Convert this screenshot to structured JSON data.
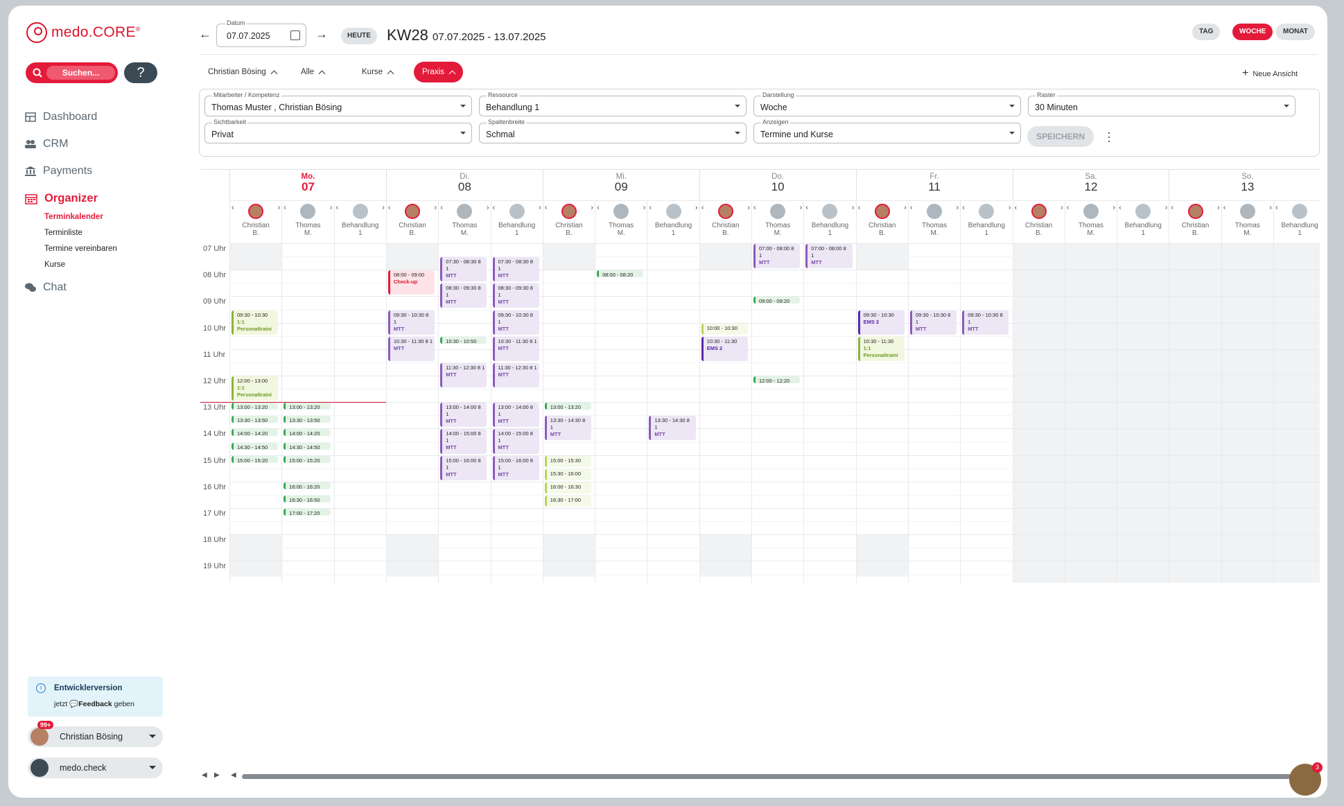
{
  "brand": {
    "name_part1": "medo.",
    "name_part2": "CORE",
    "reg": "®"
  },
  "sidebar": {
    "search_label": "Suchen...",
    "help_label": "?",
    "nav": [
      {
        "label": "Dashboard",
        "icon": "dashboard-icon"
      },
      {
        "label": "CRM",
        "icon": "people-icon"
      },
      {
        "label": "Payments",
        "icon": "bank-icon"
      },
      {
        "label": "Organizer",
        "icon": "calendar-icon",
        "active": true
      },
      {
        "label": "Chat",
        "icon": "chat-icon"
      }
    ],
    "sub": [
      {
        "label": "Terminkalender",
        "active": true
      },
      {
        "label": "Terminliste"
      },
      {
        "label": "Termine vereinbaren"
      },
      {
        "label": "Kurse"
      }
    ],
    "dev": {
      "title": "Entwicklerversion",
      "text1": "jetzt",
      "link": "Feedback",
      "text2": "geben"
    },
    "user": {
      "name": "Christian Bösing",
      "badge": "99+"
    },
    "practice": {
      "name": "medo.check"
    }
  },
  "header": {
    "date_label": "Datum",
    "date_value": "07.07.2025",
    "today_label": "HEUTE",
    "week": "KW28",
    "range": "07.07.2025 - 13.07.2025",
    "views": [
      {
        "label": "TAG"
      },
      {
        "label": "WOCHE",
        "active": true
      },
      {
        "label": "MONAT"
      }
    ],
    "chips": [
      {
        "label": "Christian Bösing"
      },
      {
        "label": "Alle"
      },
      {
        "label": "Kurse"
      },
      {
        "label": "Praxis",
        "active": true
      }
    ],
    "new_view": "Neue Ansicht"
  },
  "filters": [
    {
      "label": "Mitarbeiter / Kompetenz",
      "value": "Thomas Muster , Christian Bösing"
    },
    {
      "label": "Ressource",
      "value": "Behandlung 1"
    },
    {
      "label": "Darstellung",
      "value": "Woche"
    },
    {
      "label": "Raster",
      "value": "30 Minuten"
    },
    {
      "label": "Sichtbarkeit",
      "value": "Privat"
    },
    {
      "label": "Spaltenbreite",
      "value": "Schmal"
    },
    {
      "label": "Anzeigen",
      "value": "Termine und Kurse"
    }
  ],
  "save_label": "SPEICHERN",
  "calendar": {
    "days": [
      {
        "name": "Mo.",
        "num": "07",
        "today": true
      },
      {
        "name": "Di.",
        "num": "08"
      },
      {
        "name": "Mi.",
        "num": "09"
      },
      {
        "name": "Do.",
        "num": "10"
      },
      {
        "name": "Fr.",
        "num": "11"
      },
      {
        "name": "Sa.",
        "num": "12"
      },
      {
        "name": "So.",
        "num": "13"
      }
    ],
    "resources": [
      {
        "l1": "Christian",
        "l2": "B.",
        "type": "person"
      },
      {
        "l1": "Thomas",
        "l2": "M.",
        "type": "placeholder"
      },
      {
        "l1": "Behandlung",
        "l2": "1",
        "type": "room"
      }
    ],
    "hours": [
      "07 Uhr",
      "08 Uhr",
      "09 Uhr",
      "10 Uhr",
      "11 Uhr",
      "12 Uhr",
      "13 Uhr",
      "14 Uhr",
      "15 Uhr",
      "16 Uhr",
      "17 Uhr",
      "18 Uhr",
      "19 Uhr"
    ],
    "events": [
      {
        "col": 0,
        "start": "09:30",
        "end": "10:30",
        "time": "09:30 - 10:30",
        "name": "1:1 Personaltraini",
        "type": "pt"
      },
      {
        "col": 0,
        "start": "12:00",
        "end": "13:00",
        "time": "12:00 - 13:00",
        "name": "1:1 Personaltraini",
        "type": "pt"
      },
      {
        "col": 0,
        "start": "13:00",
        "end": "13:20",
        "time": "13:00 - 13:20",
        "name": "",
        "type": "gr"
      },
      {
        "col": 0,
        "start": "13:30",
        "end": "13:50",
        "time": "13:30 - 13:50",
        "name": "",
        "type": "gr"
      },
      {
        "col": 0,
        "start": "14:00",
        "end": "14:20",
        "time": "14:00 - 14:20",
        "name": "",
        "type": "gr"
      },
      {
        "col": 0,
        "start": "14:30",
        "end": "14:50",
        "time": "14:30 - 14:50",
        "name": "",
        "type": "gr"
      },
      {
        "col": 0,
        "start": "15:00",
        "end": "15:20",
        "time": "15:00 - 15:20",
        "name": "",
        "type": "gr"
      },
      {
        "col": 1,
        "start": "13:00",
        "end": "13:20",
        "time": "13:00 - 13:20",
        "name": "",
        "type": "gr"
      },
      {
        "col": 1,
        "start": "13:30",
        "end": "13:50",
        "time": "13:30 - 13:50",
        "name": "",
        "type": "gr"
      },
      {
        "col": 1,
        "start": "14:00",
        "end": "14:20",
        "time": "14:00 - 14:20",
        "name": "",
        "type": "gr"
      },
      {
        "col": 1,
        "start": "14:30",
        "end": "14:50",
        "time": "14:30 - 14:50",
        "name": "",
        "type": "gr"
      },
      {
        "col": 1,
        "start": "15:00",
        "end": "15:20",
        "time": "15:00 - 15:20",
        "name": "",
        "type": "gr"
      },
      {
        "col": 1,
        "start": "16:00",
        "end": "16:20",
        "time": "16:00 - 16:20",
        "name": "",
        "type": "gr"
      },
      {
        "col": 1,
        "start": "16:30",
        "end": "16:50",
        "time": "16:30 - 16:50",
        "name": "",
        "type": "gr"
      },
      {
        "col": 1,
        "start": "17:00",
        "end": "17:20",
        "time": "17:00 - 17:20",
        "name": "",
        "type": "gr"
      },
      {
        "col": 3,
        "start": "08:00",
        "end": "09:00",
        "time": "08:00 - 09:00",
        "name": "Check-up",
        "type": "ch"
      },
      {
        "col": 3,
        "start": "09:30",
        "end": "10:30",
        "time": "09:30 - 10:30 8 1",
        "name": "MTT",
        "type": "mtt"
      },
      {
        "col": 3,
        "start": "10:30",
        "end": "11:30",
        "time": "10:30 - 11:30 8 1",
        "name": "MTT",
        "type": "mtt"
      },
      {
        "col": 4,
        "start": "07:30",
        "end": "08:30",
        "time": "07:30 - 08:30 8 1",
        "name": "MTT",
        "type": "mtt"
      },
      {
        "col": 4,
        "start": "08:30",
        "end": "09:30",
        "time": "08:30 - 09:30 8 1",
        "name": "MTT",
        "type": "mtt"
      },
      {
        "col": 4,
        "start": "10:30",
        "end": "10:50",
        "time": "10:30 - 10:50",
        "name": "",
        "type": "gr"
      },
      {
        "col": 4,
        "start": "11:30",
        "end": "12:30",
        "time": "11:30 - 12:30 8 1",
        "name": "MTT",
        "type": "mtt"
      },
      {
        "col": 4,
        "start": "13:00",
        "end": "14:00",
        "time": "13:00 - 14:00 8 1",
        "name": "MTT",
        "type": "mtt"
      },
      {
        "col": 4,
        "start": "14:00",
        "end": "15:00",
        "time": "14:00 - 15:00 8 1",
        "name": "MTT",
        "type": "mtt"
      },
      {
        "col": 4,
        "start": "15:00",
        "end": "16:00",
        "time": "15:00 - 16:00 8 1",
        "name": "MTT",
        "type": "mtt"
      },
      {
        "col": 5,
        "start": "07:30",
        "end": "08:30",
        "time": "07:30 - 08:30 8 1",
        "name": "MTT",
        "type": "mtt"
      },
      {
        "col": 5,
        "start": "08:30",
        "end": "09:30",
        "time": "08:30 - 09:30 8 1",
        "name": "MTT",
        "type": "mtt"
      },
      {
        "col": 5,
        "start": "09:30",
        "end": "10:30",
        "time": "09:30 - 10:30 8 1",
        "name": "MTT",
        "type": "mtt"
      },
      {
        "col": 5,
        "start": "10:30",
        "end": "11:30",
        "time": "10:30 - 11:30 8 1",
        "name": "MTT",
        "type": "mtt"
      },
      {
        "col": 5,
        "start": "11:30",
        "end": "12:30",
        "time": "11:30 - 12:30 8 1",
        "name": "MTT",
        "type": "mtt"
      },
      {
        "col": 5,
        "start": "13:00",
        "end": "14:00",
        "time": "13:00 - 14:00 8 1",
        "name": "MTT",
        "type": "mtt"
      },
      {
        "col": 5,
        "start": "14:00",
        "end": "15:00",
        "time": "14:00 - 15:00 8 1",
        "name": "MTT",
        "type": "mtt"
      },
      {
        "col": 5,
        "start": "15:00",
        "end": "16:00",
        "time": "15:00 - 16:00 8 1",
        "name": "MTT",
        "type": "mtt"
      },
      {
        "col": 6,
        "start": "13:00",
        "end": "13:20",
        "time": "13:00 - 13:20",
        "name": "",
        "type": "gr"
      },
      {
        "col": 6,
        "start": "13:30",
        "end": "14:30",
        "time": "13:30 - 14:30 8 1",
        "name": "MTT",
        "type": "mtt"
      },
      {
        "col": 6,
        "start": "15:00",
        "end": "15:30",
        "time": "15:00 - 15:30",
        "name": "",
        "type": "lg"
      },
      {
        "col": 6,
        "start": "15:30",
        "end": "16:00",
        "time": "15:30 - 16:00",
        "name": "",
        "type": "lg"
      },
      {
        "col": 6,
        "start": "16:00",
        "end": "16:30",
        "time": "16:00 - 16:30",
        "name": "",
        "type": "lg"
      },
      {
        "col": 6,
        "start": "16:30",
        "end": "17:00",
        "time": "16:30 - 17:00",
        "name": "",
        "type": "lg"
      },
      {
        "col": 7,
        "start": "08:00",
        "end": "08:20",
        "time": "08:00 - 08:20",
        "name": "",
        "type": "gr"
      },
      {
        "col": 8,
        "start": "13:30",
        "end": "14:30",
        "time": "13:30 - 14:30 8 1",
        "name": "MTT",
        "type": "mtt"
      },
      {
        "col": 9,
        "start": "10:00",
        "end": "10:30",
        "time": "10:00 - 10:30",
        "name": "",
        "type": "lg"
      },
      {
        "col": 9,
        "start": "10:30",
        "end": "11:30",
        "time": "10:30 - 11:30",
        "name": "EMS 2",
        "type": "ems"
      },
      {
        "col": 10,
        "start": "07:00",
        "end": "08:00",
        "time": "07:00 - 08:00 8 1",
        "name": "MTT",
        "type": "mtt"
      },
      {
        "col": 10,
        "start": "09:00",
        "end": "09:20",
        "time": "09:00 - 09:20",
        "name": "",
        "type": "gr"
      },
      {
        "col": 10,
        "start": "12:00",
        "end": "12:20",
        "time": "12:00 - 12:20",
        "name": "",
        "type": "gr"
      },
      {
        "col": 11,
        "start": "07:00",
        "end": "08:00",
        "time": "07:00 - 08:00 8 1",
        "name": "MTT",
        "type": "mtt"
      },
      {
        "col": 12,
        "start": "09:30",
        "end": "10:30",
        "time": "09:30 - 10:30",
        "name": "EMS 2",
        "type": "ems"
      },
      {
        "col": 12,
        "start": "10:30",
        "end": "11:30",
        "time": "10:30 - 11:30",
        "name": "1:1 Personaltraini",
        "type": "pt"
      },
      {
        "col": 13,
        "start": "09:30",
        "end": "10:30",
        "time": "09:30 - 10:30 8 1",
        "name": "MTT",
        "type": "mtt"
      },
      {
        "col": 14,
        "start": "09:30",
        "end": "10:30",
        "time": "09:30 - 10:30 8 1",
        "name": "MTT",
        "type": "mtt"
      }
    ]
  },
  "chat_badge": "3"
}
